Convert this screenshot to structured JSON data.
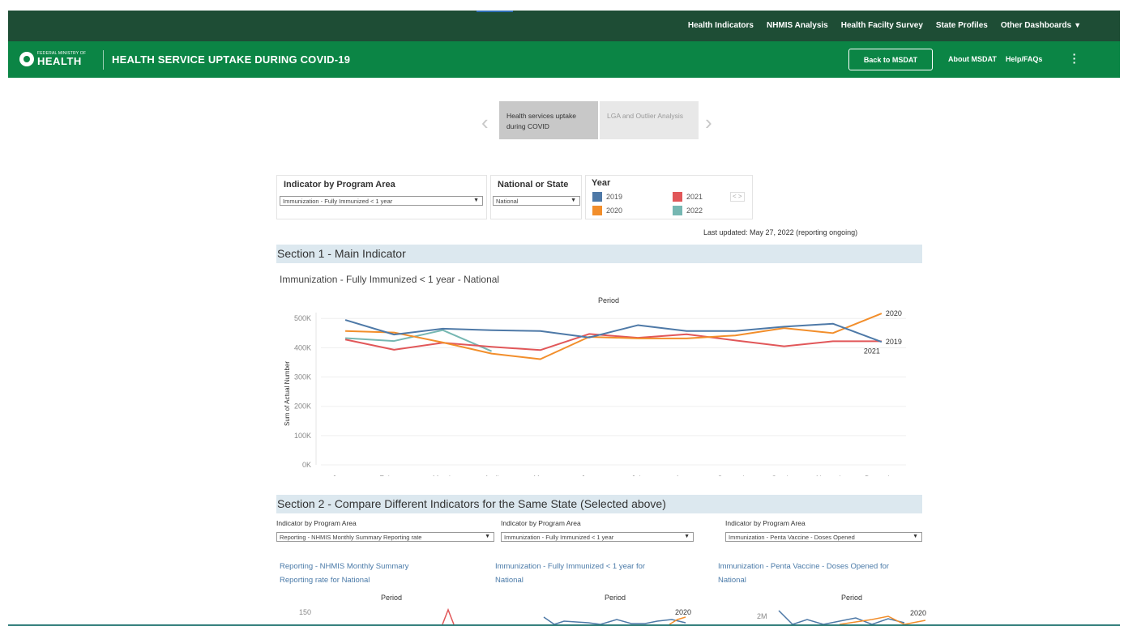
{
  "topnav": {
    "items": [
      "Health Indicators",
      "NHMIS Analysis",
      "Health Facilty Survey",
      "State Profiles",
      "Other Dashboards"
    ]
  },
  "header": {
    "logo_small": "FEDERAL MINISTRY OF",
    "logo_big": "HEALTH",
    "title": "HEALTH SERVICE UPTAKE DURING COVID-19",
    "back_button": "Back to MSDAT",
    "about": "About MSDAT",
    "help": "Help/FAQs"
  },
  "story": {
    "points": [
      {
        "label": "Health services uptake during COVID",
        "active": true
      },
      {
        "label": "LGA and Outlier Analysis",
        "active": false
      }
    ]
  },
  "filters": {
    "indicator": {
      "title": "Indicator by Program Area",
      "value": "Immunization - Fully Immunized < 1 year"
    },
    "region": {
      "title": "National or State",
      "value": "National"
    },
    "year": {
      "title": "Year",
      "items": [
        {
          "label": "2019",
          "color": "#4e79a7"
        },
        {
          "label": "2021",
          "color": "#e15759"
        },
        {
          "label": "2020",
          "color": "#f28e2b"
        },
        {
          "label": "2022",
          "color": "#76b7b2"
        }
      ],
      "pager": "< >"
    }
  },
  "last_updated": "Last updated: May 27, 2022 (reporting ongoing)",
  "section1": {
    "title": "Section 1 - Main Indicator",
    "chart_title": "Immunization - Fully Immunized < 1 year - National"
  },
  "chart_data": {
    "type": "line",
    "title": "Period",
    "ylabel": "Sum of Actual Number",
    "categories": [
      "January",
      "February",
      "March",
      "April",
      "May",
      "June",
      "July",
      "August",
      "September",
      "October",
      "November",
      "December"
    ],
    "yticks": [
      "0K",
      "100K",
      "200K",
      "300K",
      "400K",
      "500K"
    ],
    "ylim": [
      0,
      520000
    ],
    "series": [
      {
        "name": "2019",
        "color": "#4e79a7",
        "values": [
          495000,
          445000,
          465000,
          460000,
          457000,
          435000,
          477000,
          457000,
          457000,
          472000,
          482000,
          420000
        ]
      },
      {
        "name": "2020",
        "color": "#f28e2b",
        "values": [
          457000,
          452000,
          418000,
          380000,
          361000,
          437000,
          432000,
          432000,
          442000,
          467000,
          450000,
          517000
        ]
      },
      {
        "name": "2021",
        "color": "#e15759",
        "values": [
          428000,
          393000,
          417000,
          403000,
          392000,
          447000,
          434000,
          446000,
          425000,
          405000,
          422000,
          422000
        ]
      },
      {
        "name": "2022",
        "color": "#76b7b2",
        "values": [
          433000,
          423000,
          460000,
          388000
        ]
      }
    ],
    "end_labels": [
      "2020",
      "2019",
      "2021"
    ]
  },
  "section2": {
    "title": "Section 2 - Compare Different Indicators for the Same State (Selected above)",
    "columns": [
      {
        "filter_title": "Indicator by Program Area",
        "filter_value": "Reporting - NHMIS Monthly Summary Reporting rate",
        "chart_title_1": "Reporting - NHMIS Monthly Summary",
        "chart_title_2": "Reporting rate for National",
        "period": "Period",
        "ytick": "150",
        "end_label": ""
      },
      {
        "filter_title": "Indicator by Program Area",
        "filter_value": "Immunization - Fully Immunized < 1 year",
        "chart_title_1": "Immunization - Fully Immunized < 1 year for",
        "chart_title_2": "National",
        "period": "Period",
        "ytick": "",
        "end_label": "2020"
      },
      {
        "filter_title": "Indicator by Program Area",
        "filter_value": "Immunization - Penta Vaccine - Doses Opened",
        "chart_title_1": "Immunization - Penta Vaccine - Doses Opened for",
        "chart_title_2": "National",
        "period": "Period",
        "ytick": "2M",
        "end_label": "2020"
      }
    ]
  }
}
